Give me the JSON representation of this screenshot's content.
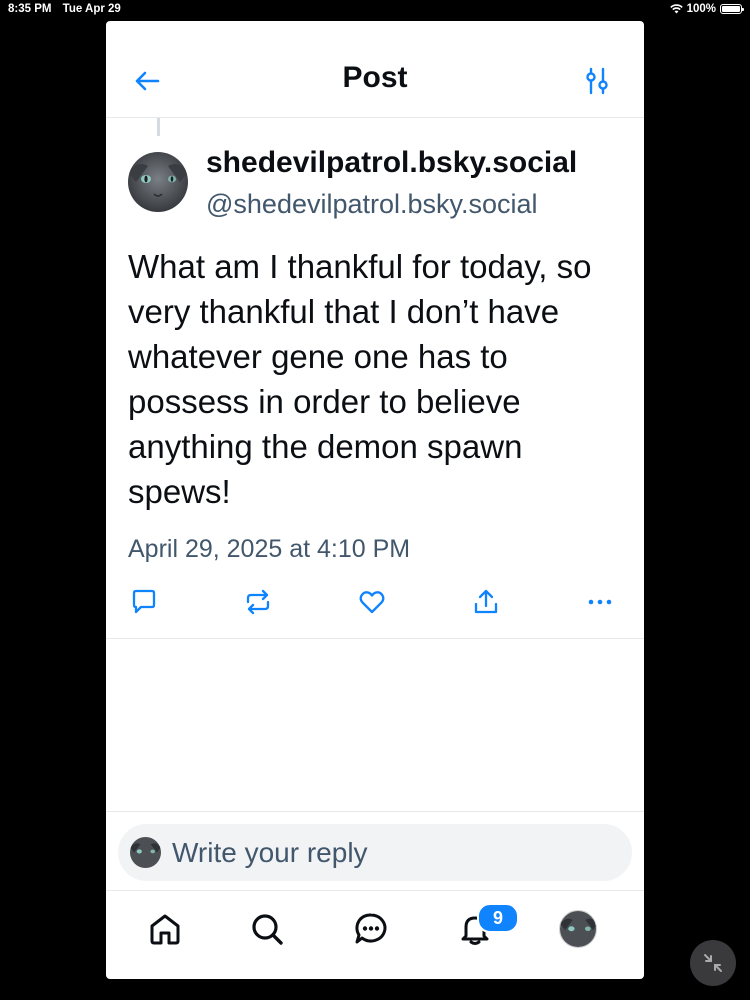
{
  "statusbar": {
    "time": "8:35 PM",
    "date": "Tue Apr 29",
    "battery": "100%",
    "wifi_icon": "wifi-icon",
    "battery_icon": "battery-icon"
  },
  "header": {
    "title": "Post",
    "back_icon": "arrow-left-icon",
    "settings_icon": "sliders-icon"
  },
  "post": {
    "display_name": "shedevilpatrol.bsky.social",
    "handle": "@shedevilpatrol.bsky.social",
    "text": "What am I thankful for today, so very thankful that I don’t have whatever gene one has to possess in order to believe anything the demon spawn spews!",
    "date": "April 29, 2025 at 4:10 PM",
    "actions": [
      "reply-icon",
      "repost-icon",
      "like-icon",
      "share-icon",
      "more-icon"
    ]
  },
  "reply": {
    "placeholder": "Write your reply"
  },
  "tabbar": {
    "items": [
      "home-icon",
      "search-icon",
      "chat-icon",
      "notifications-icon",
      "profile-avatar"
    ],
    "notification_count": "9"
  },
  "colors": {
    "text": "#0b0f14",
    "muted": "#42576c",
    "accent": "#1083fe",
    "border": "#e6e9ec"
  }
}
